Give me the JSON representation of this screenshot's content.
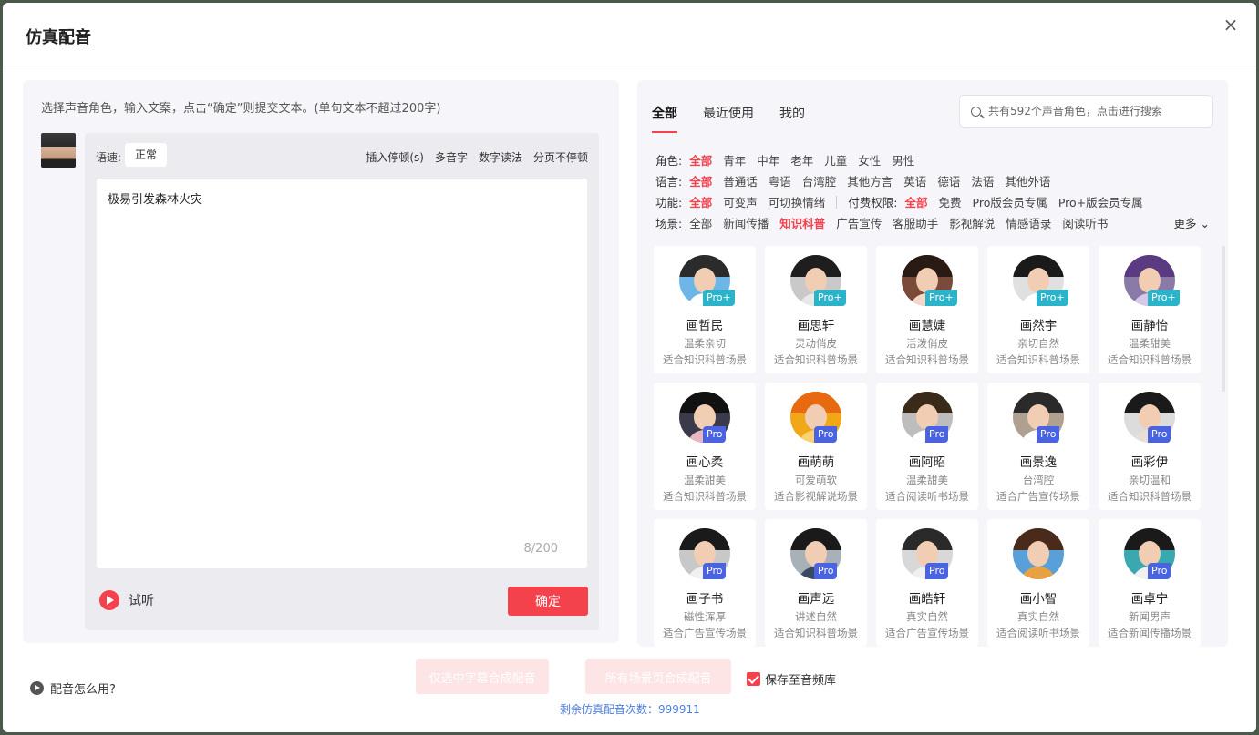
{
  "modal": {
    "title": "仿真配音",
    "close": "×"
  },
  "left": {
    "hint": "选择声音角色，输入文案，点击“确定”则提交文本。(单句文本不超过200字)",
    "speed_label": "语速:",
    "speed_value": "正常",
    "tools": [
      "插入停顿(s)",
      "多音字",
      "数字读法",
      "分页不停顿"
    ],
    "text": "极易引发森林火灾",
    "char_count": "8/200",
    "listen": "试听",
    "confirm": "确定"
  },
  "right": {
    "tabs": [
      "全部",
      "最近使用",
      "我的"
    ],
    "search_placeholder": "共有592个声音角色，点击进行搜索",
    "filters": {
      "role": {
        "label": "角色:",
        "options": [
          "全部",
          "青年",
          "中年",
          "老年",
          "儿童",
          "女性",
          "男性"
        ]
      },
      "language": {
        "label": "语言:",
        "options": [
          "全部",
          "普通话",
          "粤语",
          "台湾腔",
          "其他方言",
          "英语",
          "德语",
          "法语",
          "其他外语"
        ]
      },
      "function": {
        "label": "功能:",
        "options": [
          "全部",
          "可变声",
          "可切换情绪"
        ]
      },
      "paid": {
        "label": "付费权限:",
        "options": [
          "全部",
          "免费",
          "Pro版会员专属",
          "Pro+版会员专属"
        ]
      },
      "scene": {
        "label": "场景:",
        "options": [
          "全部",
          "新闻传播",
          "知识科普",
          "广告宣传",
          "客服助手",
          "影视解说",
          "情感语录",
          "阅读听书"
        ]
      },
      "more": "更多"
    },
    "voices": [
      {
        "name": "画哲民",
        "style": "温柔亲切",
        "scene": "适合知识科普场景",
        "badge": "Pro+"
      },
      {
        "name": "画思轩",
        "style": "灵动俏皮",
        "scene": "适合知识科普场景",
        "badge": "Pro+"
      },
      {
        "name": "画慧婕",
        "style": "活泼俏皮",
        "scene": "适合知识科普场景",
        "badge": "Pro+"
      },
      {
        "name": "画然宇",
        "style": "亲切自然",
        "scene": "适合知识科普场景",
        "badge": "Pro+"
      },
      {
        "name": "画静怡",
        "style": "温柔甜美",
        "scene": "适合知识科普场景",
        "badge": "Pro+"
      },
      {
        "name": "画心柔",
        "style": "温柔甜美",
        "scene": "适合知识科普场景",
        "badge": "Pro"
      },
      {
        "name": "画萌萌",
        "style": "可爱萌软",
        "scene": "适合影视解说场景",
        "badge": "Pro"
      },
      {
        "name": "画阿昭",
        "style": "温柔甜美",
        "scene": "适合阅读听书场景",
        "badge": "Pro"
      },
      {
        "name": "画景逸",
        "style": "台湾腔",
        "scene": "适合广告宣传场景",
        "badge": "Pro"
      },
      {
        "name": "画彩伊",
        "style": "亲切温和",
        "scene": "适合知识科普场景",
        "badge": "Pro"
      },
      {
        "name": "画子书",
        "style": "磁性浑厚",
        "scene": "适合广告宣传场景",
        "badge": "Pro"
      },
      {
        "name": "画声远",
        "style": "讲述自然",
        "scene": "适合知识科普场景",
        "badge": "Pro"
      },
      {
        "name": "画皓轩",
        "style": "真实自然",
        "scene": "适合广告宣传场景",
        "badge": "Pro"
      },
      {
        "name": "画小智",
        "style": "真实自然",
        "scene": "适合阅读听书场景",
        "badge": ""
      },
      {
        "name": "画卓宁",
        "style": "新闻男声",
        "scene": "适合新闻传播场景",
        "badge": "Pro"
      }
    ]
  },
  "footer": {
    "help": "配音怎么用?",
    "btn_selected": "仅选中字幕合成配音",
    "btn_all": "所有场景页合成配音",
    "save": "保存至音频库",
    "remaining": "剩余仿真配音次数：999911"
  },
  "colors": {
    "accent": "#f3424c",
    "pro_plus_badge": "#2bb4c9",
    "pro_badge": "#4a63e0",
    "link": "#4a7ee0"
  }
}
